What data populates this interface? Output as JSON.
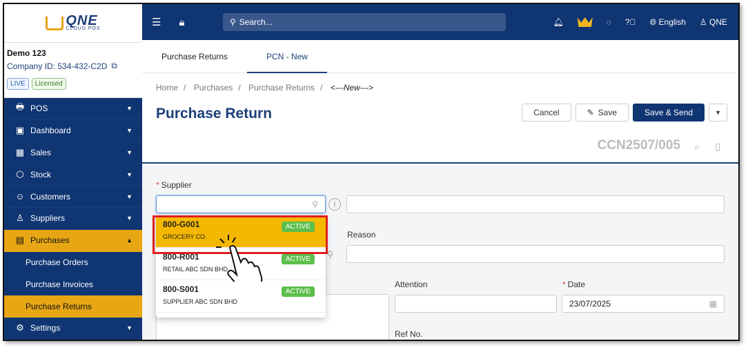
{
  "sidebar": {
    "logo": {
      "brand": "QNE",
      "sub": "CLOUD POS"
    },
    "company": {
      "name": "Demo 123",
      "id": "Company ID: 534-432-C2D",
      "badges": [
        "LIVE",
        "Licensed"
      ]
    },
    "menu": [
      {
        "label": "POS",
        "icon": "pos-icon"
      },
      {
        "label": "Dashboard",
        "icon": "dashboard-icon"
      },
      {
        "label": "Sales",
        "icon": "sales-icon"
      },
      {
        "label": "Stock",
        "icon": "stock-icon"
      },
      {
        "label": "Customers",
        "icon": "customers-icon"
      },
      {
        "label": "Suppliers",
        "icon": "suppliers-icon"
      },
      {
        "label": "Purchases",
        "icon": "purchases-icon"
      }
    ],
    "purchases_sub": [
      "Purchase Orders",
      "Purchase Invoices",
      "Purchase Returns"
    ],
    "settings": "Settings"
  },
  "topbar": {
    "search_placeholder": "Search...",
    "language": "English",
    "user": "QNE"
  },
  "tabs": [
    "Purchase Returns",
    "PCN - New"
  ],
  "breadcrumb": [
    "Home",
    "Purchases",
    "Purchase Returns",
    "<---New--->"
  ],
  "page": {
    "title": "Purchase Return",
    "cancel": "Cancel",
    "save": "Save",
    "save_send": "Save & Send",
    "doc_no": "CCN2507/005"
  },
  "form": {
    "supplier_label": "Supplier",
    "reason_label": "Reason",
    "attention_label": "Attention",
    "date_label": "Date",
    "date_value": "23/07/2025",
    "refno_label": "Ref No."
  },
  "supplier_options": [
    {
      "code": "800-G001",
      "name": "GROCERY CO.",
      "status": "ACTIVE"
    },
    {
      "code": "800-R001",
      "name": "RETAIL ABC SDN BHD",
      "status": "ACTIVE"
    },
    {
      "code": "800-S001",
      "name": "SUPPLIER ABC SDN BHD",
      "status": "ACTIVE"
    }
  ]
}
